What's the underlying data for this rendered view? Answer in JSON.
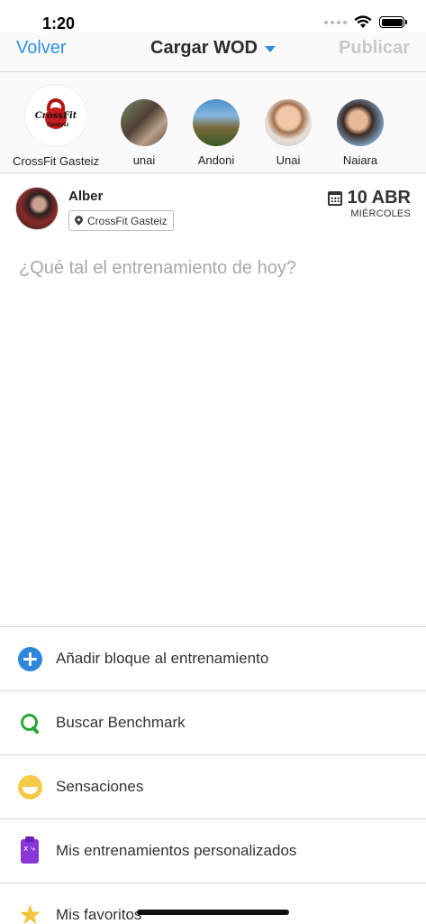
{
  "status_bar": {
    "time": "1:20"
  },
  "nav": {
    "back_label": "Volver",
    "title": "Cargar WOD",
    "publish_label": "Publicar",
    "accent_color": "#2d8fe0"
  },
  "stories": [
    {
      "label": "CrossFit Gasteiz",
      "logo_text": "CrossFit",
      "logo_subtext": "Gasteiz"
    },
    {
      "label": "unai"
    },
    {
      "label": "Andoni"
    },
    {
      "label": "Unai"
    },
    {
      "label": "Naiara"
    }
  ],
  "post": {
    "user": "Alber",
    "location": "CrossFit Gasteiz",
    "date": "10 ABR",
    "weekday": "MIÉRCOLES",
    "placeholder": "¿Qué tal el entrenamiento de hoy?"
  },
  "options": [
    {
      "label": "Añadir bloque al entrenamiento",
      "icon": "plus-circle-icon",
      "color": "#2b86dc"
    },
    {
      "label": "Buscar Benchmark",
      "icon": "search-icon",
      "color": "#2aa63a"
    },
    {
      "label": "Sensaciones",
      "icon": "smile-icon",
      "color": "#f7c948"
    },
    {
      "label": "Mis entrenamientos personalizados",
      "icon": "clipboard-icon",
      "color": "#8a35d8"
    },
    {
      "label": "Mis favoritos",
      "icon": "star-icon",
      "color": "#f3c23a"
    }
  ]
}
